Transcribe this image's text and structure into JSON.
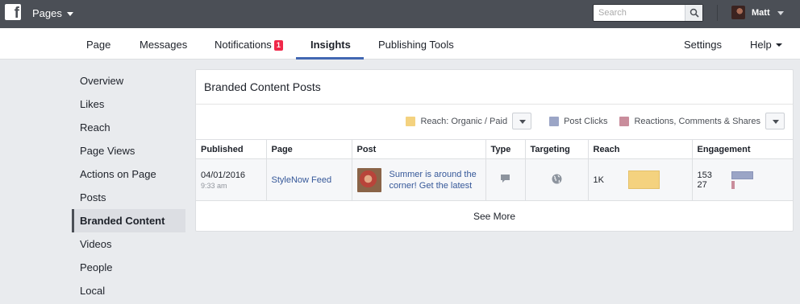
{
  "topbar": {
    "logo_letter": "f",
    "pages_label": "Pages",
    "search_placeholder": "Search",
    "user_name": "Matt"
  },
  "nav": {
    "page": "Page",
    "messages": "Messages",
    "notifications": "Notifications",
    "notifications_badge": "1",
    "insights": "Insights",
    "publishing_tools": "Publishing Tools",
    "settings": "Settings",
    "help": "Help"
  },
  "sidebar": {
    "items": [
      {
        "label": "Overview"
      },
      {
        "label": "Likes"
      },
      {
        "label": "Reach"
      },
      {
        "label": "Page Views"
      },
      {
        "label": "Actions on Page"
      },
      {
        "label": "Posts"
      },
      {
        "label": "Branded Content"
      },
      {
        "label": "Videos"
      },
      {
        "label": "People"
      },
      {
        "label": "Local"
      }
    ],
    "active_index": 6
  },
  "card": {
    "title": "Branded Content Posts",
    "legend": {
      "reach_label": "Reach: Organic / Paid",
      "clicks_label": "Post Clicks",
      "reactions_label": "Reactions, Comments & Shares"
    },
    "columns": [
      "Published",
      "Page",
      "Post",
      "Type",
      "Targeting",
      "Reach",
      "Engagement"
    ],
    "rows": [
      {
        "date": "04/01/2016",
        "time": "9:33 am",
        "page": "StyleNow Feed",
        "post": "Summer is around the corner! Get the latest",
        "type_icon": "status-icon",
        "targeting_icon": "globe-icon",
        "reach": "1K",
        "engagement_clicks": "153",
        "engagement_reactions": "27"
      }
    ],
    "see_more": "See More"
  },
  "colors": {
    "topbar": "#4b4f56",
    "accent": "#4267b2",
    "reach": "#f4d27f",
    "clicks": "#9ba5c6",
    "reactions": "#c98d9c",
    "link": "#365899"
  }
}
